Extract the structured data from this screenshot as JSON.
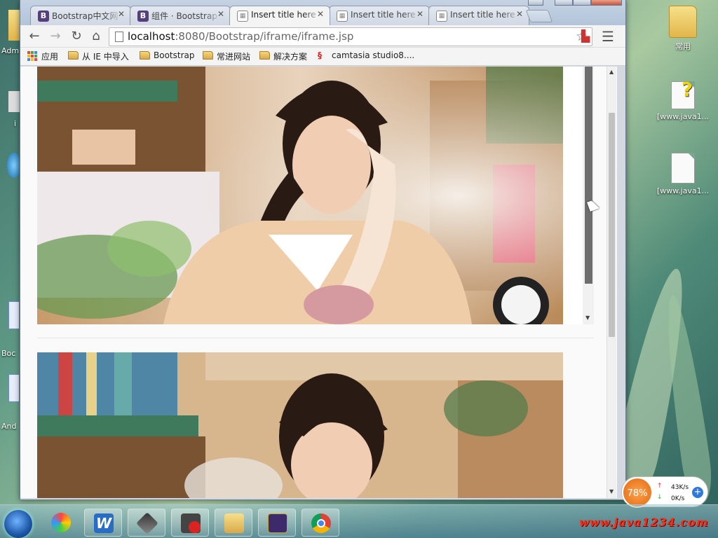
{
  "browser": {
    "tabs": [
      {
        "label": "Bootstrap中文网",
        "favicon": "bootstrap-icon",
        "active": false
      },
      {
        "label": "组件 · Bootstrap",
        "favicon": "bootstrap-icon",
        "active": false
      },
      {
        "label": "Insert title here",
        "favicon": "page-icon",
        "active": true
      },
      {
        "label": "Insert title here",
        "favicon": "page-icon",
        "active": false
      },
      {
        "label": "Insert title here",
        "favicon": "page-icon",
        "active": false
      }
    ],
    "address": {
      "host": "localhost",
      "path": ":8080/Bootstrap/iframe/iframe.jsp"
    },
    "bookmarks": [
      "应用",
      "从 IE 中导入",
      "Bootstrap",
      "常进网站",
      "解决方案",
      "camtasia studio8...."
    ]
  },
  "desktop": {
    "icons": [
      {
        "label": "常用",
        "type": "folder"
      },
      {
        "label": "[www.java1...",
        "type": "help-doc"
      },
      {
        "label": "[www.java1...",
        "type": "blank-doc"
      }
    ],
    "left_labels": [
      "Adm",
      "i",
      "Boc",
      "And"
    ]
  },
  "tray": {
    "cpu_pct": "78%",
    "upload": "43K/s",
    "download": "0K/s"
  },
  "watermark": "www.java1234.com",
  "colors": {
    "accent": "#563d7c",
    "tray_orange": "#e06a12",
    "watermark": "#ff2a10"
  }
}
